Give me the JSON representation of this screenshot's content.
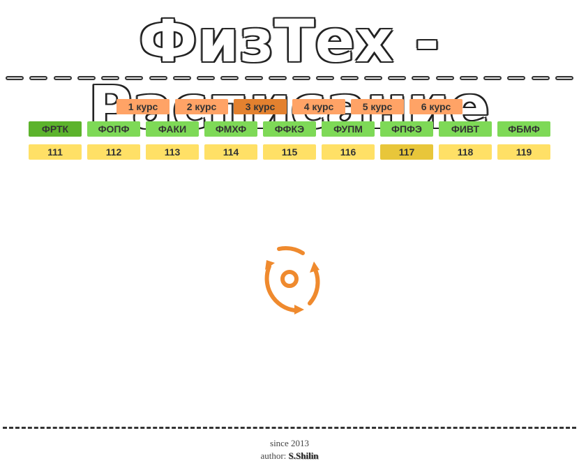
{
  "header": {
    "title": "ФизТех - Расписание"
  },
  "courses": [
    {
      "label": "1 курс",
      "active": false
    },
    {
      "label": "2 курс",
      "active": false
    },
    {
      "label": "3 курс",
      "active": true
    },
    {
      "label": "4 курс",
      "active": false
    },
    {
      "label": "5 курс",
      "active": false
    },
    {
      "label": "6 курс",
      "active": false
    }
  ],
  "faculties": [
    {
      "label": "ФРТК",
      "active": true
    },
    {
      "label": "ФОПФ",
      "active": false
    },
    {
      "label": "ФАКИ",
      "active": false
    },
    {
      "label": "ФМХФ",
      "active": false
    },
    {
      "label": "ФФКЭ",
      "active": false
    },
    {
      "label": "ФУПМ",
      "active": false
    },
    {
      "label": "ФПФЭ",
      "active": false
    },
    {
      "label": "ФИВТ",
      "active": false
    },
    {
      "label": "ФБМФ",
      "active": false
    }
  ],
  "groups": [
    {
      "label": "111",
      "active": false
    },
    {
      "label": "112",
      "active": false
    },
    {
      "label": "113",
      "active": false
    },
    {
      "label": "114",
      "active": false
    },
    {
      "label": "115",
      "active": false
    },
    {
      "label": "116",
      "active": false
    },
    {
      "label": "117",
      "active": true
    },
    {
      "label": "118",
      "active": false
    },
    {
      "label": "119",
      "active": false
    }
  ],
  "spinner": {
    "icon": "loading-spinner-icon",
    "color": "#ef8a2e"
  },
  "colors": {
    "course_pill": "#ffa366",
    "course_active": "#e3812f",
    "faculty_pill": "#7ed957",
    "faculty_active": "#5cb32c",
    "group_pill": "#ffe066",
    "group_active": "#e8c63a"
  },
  "footer": {
    "since": "since 2013",
    "author_label": "author:",
    "author_name": "S.Shilin"
  }
}
